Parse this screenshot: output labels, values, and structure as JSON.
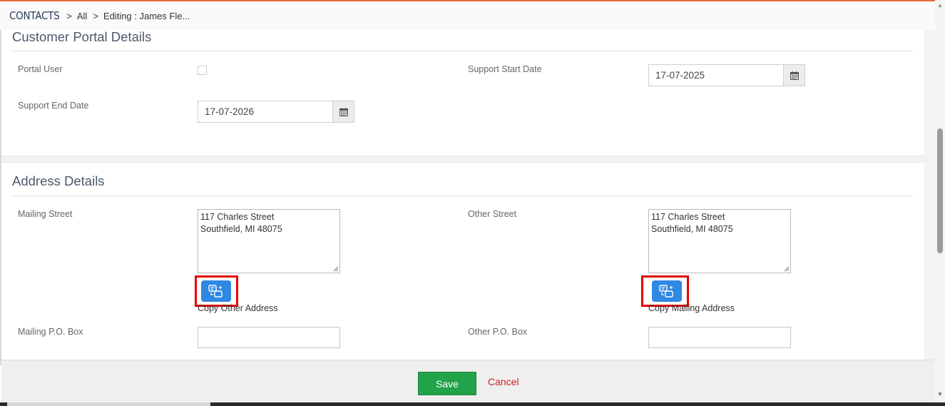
{
  "breadcrumb": {
    "module": "CONTACTS",
    "sep": ">",
    "all": "All",
    "current": "Editing : James Fle..."
  },
  "portal_section": {
    "title": "Customer Portal Details",
    "portal_user_label": "Portal User",
    "portal_user_checked": false,
    "support_start_label": "Support Start Date",
    "support_start_value": "17-07-2025",
    "support_end_label": "Support End Date",
    "support_end_value": "17-07-2026"
  },
  "address_section": {
    "title": "Address Details",
    "mailing_street_label": "Mailing Street",
    "mailing_street_lines": [
      "117 Charles Street",
      "Southfield, MI 48075"
    ],
    "other_street_label": "Other Street",
    "other_street_lines": [
      "117 Charles Street",
      "Southfield, MI 48075"
    ],
    "copy_other_label": "Copy Other Address",
    "copy_mailing_label": "Copy Mailing Address",
    "mailing_pobox_label": "Mailing P.O. Box",
    "other_pobox_label": "Other P.O. Box"
  },
  "footer": {
    "save_label": "Save",
    "cancel_label": "Cancel"
  },
  "colors": {
    "accent": "#e86a3a",
    "save": "#22a34a",
    "cancel": "#d01e1e",
    "copy_button": "#2f88e2",
    "highlight": "#e30000"
  },
  "icons": {
    "calendar": "calendar-icon",
    "copy_address": "copy-address-icon"
  }
}
